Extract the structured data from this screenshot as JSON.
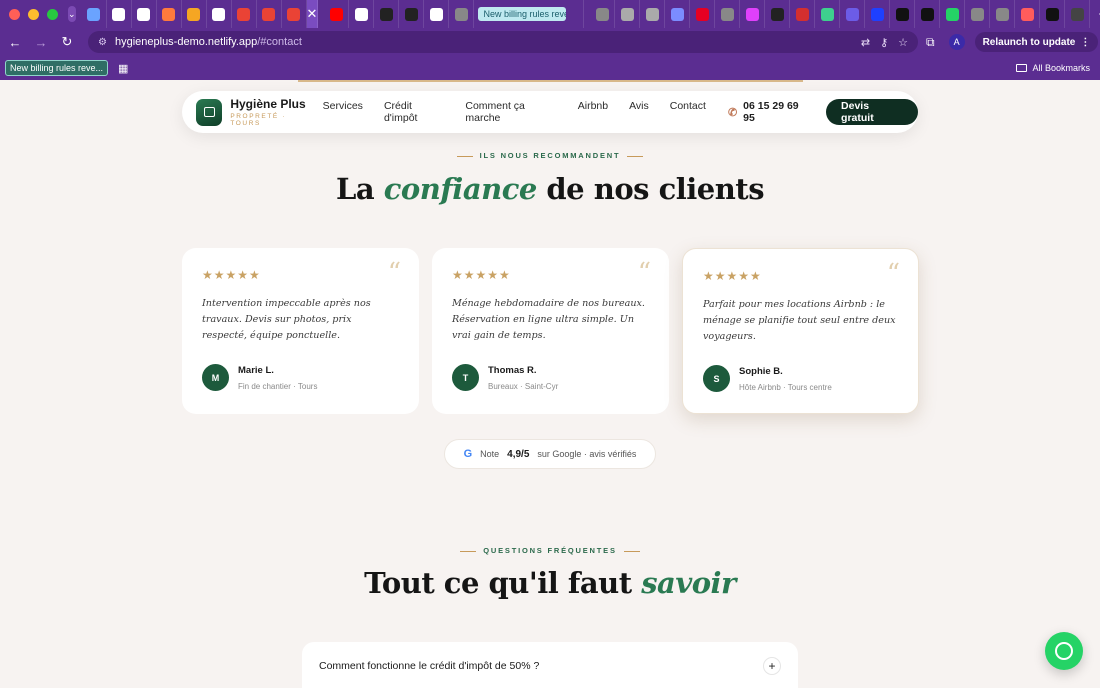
{
  "browser": {
    "traffic_colors": [
      "#ff5f57",
      "#febc2e",
      "#28c840"
    ],
    "tab_colors": [
      "#6aa3ff",
      "#ffffff",
      "#ffffff",
      "#ff7a3d",
      "#f5a623",
      "#ffffff",
      "#ea4335",
      "#ea4335",
      "#ea4335",
      "#7a4cc0",
      "#ff0000",
      "#ffffff",
      "#222222",
      "#222222",
      "#ffffff",
      "#888888"
    ],
    "active_tab_title": "New billing rules reve...",
    "right_tab_colors": [
      "#888888",
      "#aaaaaa",
      "#aaaaaa",
      "#7b8cff",
      "#e60023",
      "#888888",
      "#e040fb",
      "#222222",
      "#d32f2f",
      "#3ecf8e",
      "#6c5ce7",
      "#1e40ff",
      "#111111",
      "#111111",
      "#25d366",
      "#888888",
      "#888888",
      "#ff5c5c",
      "#111111",
      "#444444"
    ],
    "url_host": "hygieneplus-demo.netlify.app",
    "url_path": "/#contact",
    "profile_initial": "A",
    "relaunch_label": "Relaunch to update",
    "bookmark_pill": "New billing rules reve...",
    "all_bookmarks": "All Bookmarks"
  },
  "site": {
    "brand_name": "Hygiène Plus",
    "brand_tag": "PROPRETÉ · TOURS",
    "nav_links": [
      "Services",
      "Crédit d'impôt",
      "Comment ça marche",
      "Airbnb",
      "Avis",
      "Contact"
    ],
    "phone": "06 15 29 69 95",
    "cta": "Devis gratuit"
  },
  "testimonials": {
    "eyebrow": "ILS NOUS RECOMMANDENT",
    "title_before": "La ",
    "title_em": "confiance",
    "title_after": " de nos clients",
    "stars": "★★★★★",
    "quote_glyph": "“",
    "cards": [
      {
        "text": "Intervention impeccable après nos travaux. Devis sur photos, prix respecté, équipe ponctuelle.",
        "initial": "M",
        "name": "Marie L.",
        "meta": "Fin de chantier · Tours"
      },
      {
        "text": "Ménage hebdomadaire de nos bureaux. Réservation en ligne ultra simple. Un vrai gain de temps.",
        "initial": "T",
        "name": "Thomas R.",
        "meta": "Bureaux · Saint-Cyr"
      },
      {
        "text": "Parfait pour mes locations Airbnb : le ménage se planifie tout seul entre deux voyageurs.",
        "initial": "S",
        "name": "Sophie B.",
        "meta": "Hôte Airbnb · Tours centre"
      }
    ],
    "rating_label": "Note",
    "rating_value": "4,9/5",
    "rating_suffix": "sur Google · avis vérifiés"
  },
  "faq": {
    "eyebrow": "QUESTIONS FRÉQUENTES",
    "title_before": "Tout ce qu'il faut ",
    "title_em": "savoir",
    "items": [
      {
        "question": "Comment fonctionne le crédit d'impôt de 50% ?"
      }
    ]
  }
}
